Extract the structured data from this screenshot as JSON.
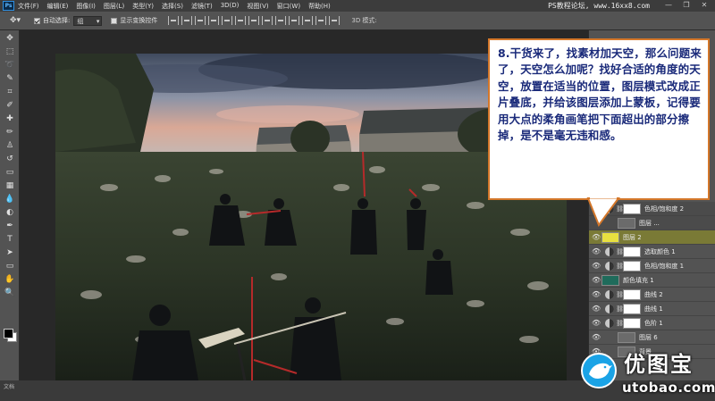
{
  "app": {
    "logo_text": "Ps",
    "menu": [
      "文件(F)",
      "编辑(E)",
      "图像(I)",
      "图层(L)",
      "类型(Y)",
      "选择(S)",
      "滤镜(T)",
      "3D(D)",
      "视图(V)",
      "窗口(W)",
      "帮助(H)"
    ],
    "watermark": "PS教程论坛, www.16xx8.com",
    "window_controls": [
      "—",
      "❐",
      "✕"
    ]
  },
  "options": {
    "auto_select_label": "自动选择:",
    "auto_select_value": "组",
    "transform_label": "显示变换控件",
    "mode_3d_label": "3D 模式:"
  },
  "toolbox": {
    "tools": [
      "move-icon",
      "marquee-icon",
      "lasso-icon",
      "quick-select-icon",
      "crop-icon",
      "eyedropper-icon",
      "healing-icon",
      "brush-icon",
      "stamp-icon",
      "history-brush-icon",
      "eraser-icon",
      "gradient-icon",
      "blur-icon",
      "dodge-icon",
      "pen-icon",
      "type-icon",
      "path-select-icon",
      "shape-icon",
      "hand-icon",
      "zoom-icon"
    ],
    "glyphs": [
      "✥",
      "⬚",
      "➰",
      "✎",
      "⌗",
      "✐",
      "✚",
      "✏",
      "♙",
      "↺",
      "▭",
      "▦",
      "💧",
      "◐",
      "✒",
      "T",
      "➤",
      "▭",
      "✋",
      "🔍"
    ],
    "fg_color": "#000000",
    "bg_color": "#ffffff"
  },
  "layers": [
    {
      "name": "色相/饱和度 2",
      "kind": "adjustment",
      "visible": false
    },
    {
      "name": "图层 ...",
      "kind": "pixel",
      "visible": false
    },
    {
      "name": "图层 2",
      "kind": "pixel",
      "visible": true,
      "selected": true,
      "thumb_color": "#e8e040"
    },
    {
      "name": "选取颜色 1",
      "kind": "adjustment",
      "visible": true
    },
    {
      "name": "色相/饱和度 1",
      "kind": "adjustment",
      "visible": true
    },
    {
      "name": "颜色填充 1",
      "kind": "fill",
      "visible": true,
      "thumb_color": "#1f6b5b"
    },
    {
      "name": "曲线 2",
      "kind": "adjustment",
      "visible": true
    },
    {
      "name": "曲线 1",
      "kind": "adjustment",
      "visible": true
    },
    {
      "name": "色阶 1",
      "kind": "adjustment",
      "visible": true
    },
    {
      "name": "图层 6",
      "kind": "pixel",
      "visible": true
    },
    {
      "name": "背景",
      "kind": "pixel",
      "visible": true
    }
  ],
  "callout": {
    "text": "8.干货来了，找素材加天空，那么问题来了，天空怎么加呢？找好合适的角度的天空，放置在适当的位置，图层模式改成正片叠底，并给该图层添加上蒙板，记得要用大点的柔角画笔把下面超出的部分擦掉，是不是毫无违和感。",
    "border_color": "#d4772a",
    "text_color": "#1a2a7a"
  },
  "logo": {
    "name": "优图宝",
    "url": "utobao.com",
    "accent_color": "#1aa3e6"
  },
  "status": {
    "text": "文档"
  }
}
